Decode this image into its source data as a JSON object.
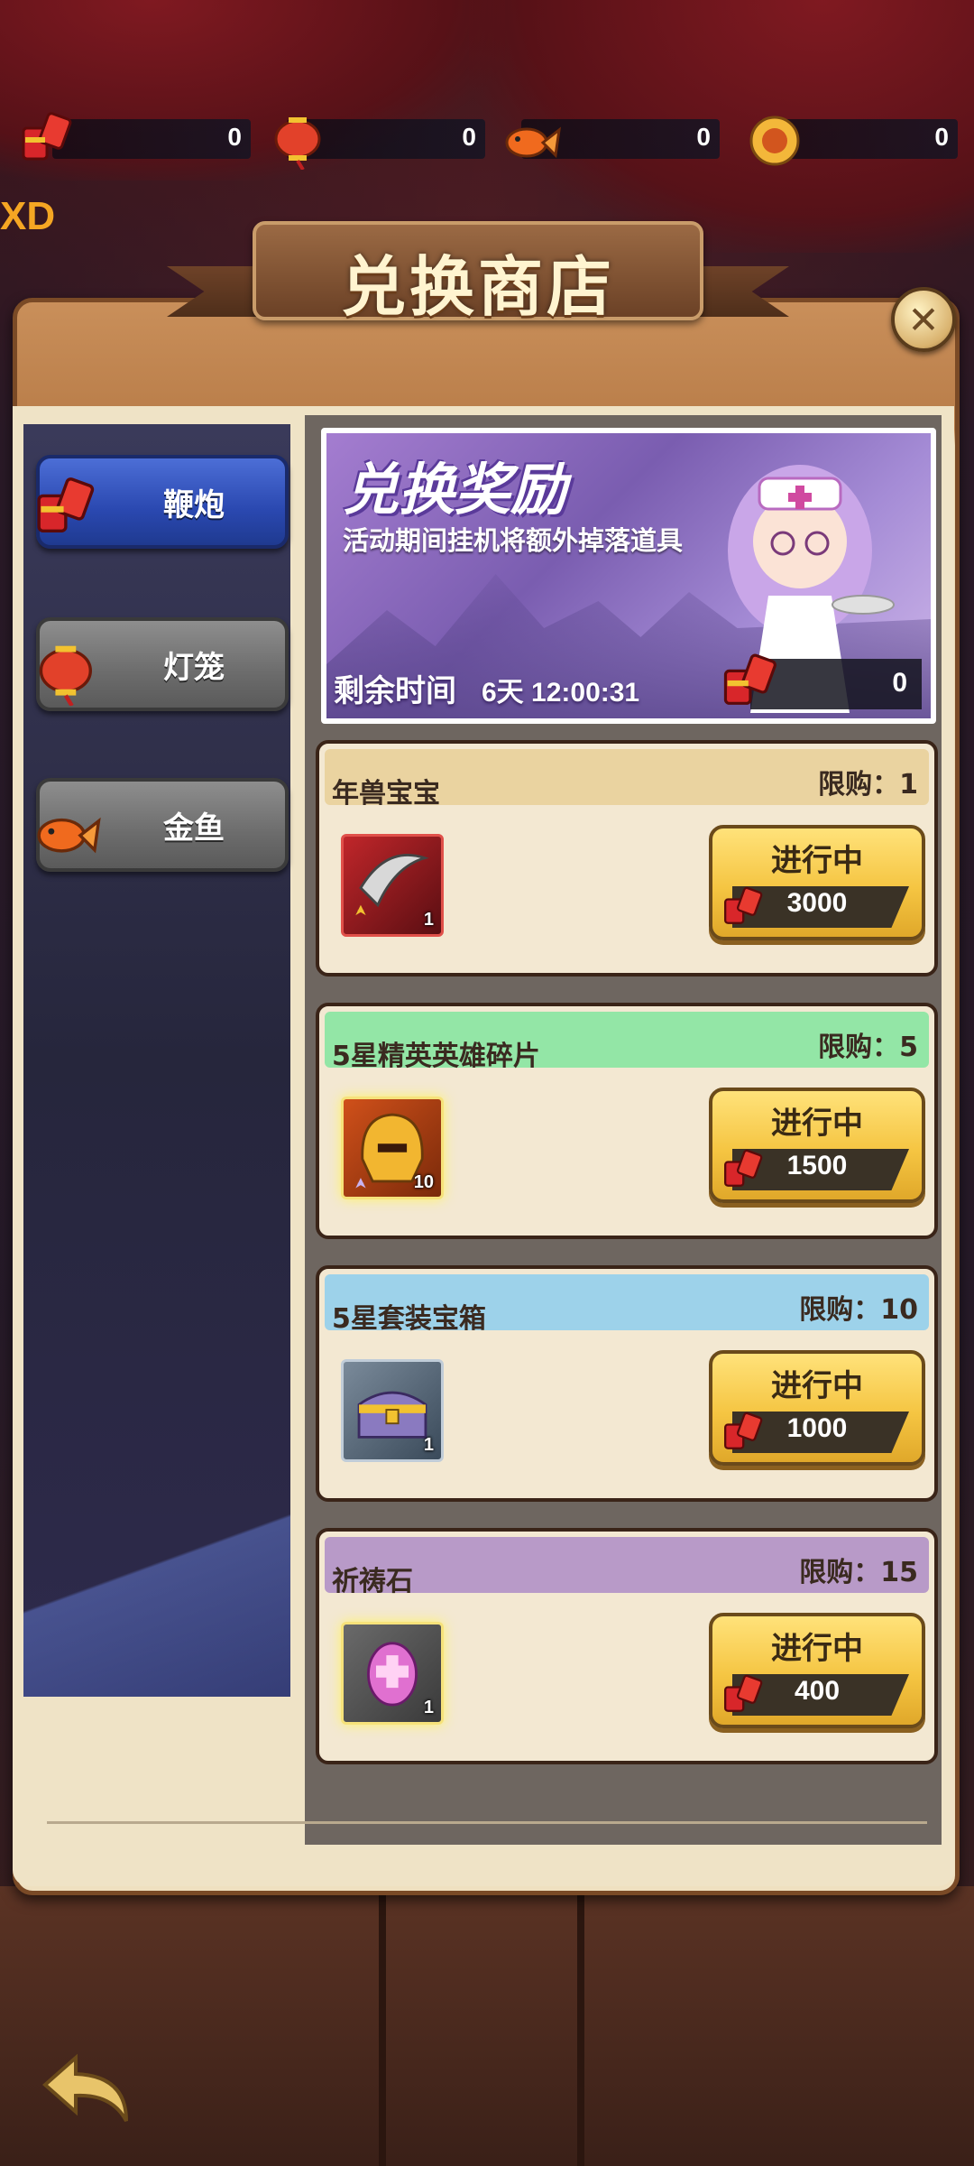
{
  "top_bar": {
    "currencies": [
      {
        "name": "firecracker-icon",
        "value": "0"
      },
      {
        "name": "lantern-icon",
        "value": "0"
      },
      {
        "name": "goldfish-icon",
        "value": "0"
      },
      {
        "name": "gold-coin-icon",
        "value": "0"
      }
    ],
    "edge_label": "XD"
  },
  "title": "兑换商店",
  "categories": [
    {
      "label": "鞭炮",
      "icon": "firecracker-icon",
      "active": true
    },
    {
      "label": "灯笼",
      "icon": "lantern-icon",
      "active": false
    },
    {
      "label": "金鱼",
      "icon": "goldfish-icon",
      "active": false
    }
  ],
  "banner": {
    "title": "兑换奖励",
    "subtitle": "活动期间挂机将额外掉落道具",
    "time_label": "剩余时间",
    "time_value": "6天 12:00:31",
    "owned_count": "0"
  },
  "items": [
    {
      "name": "年兽宝宝",
      "limit": "限购：1",
      "count": "1",
      "button": "进行中",
      "price": "3000",
      "header_color": "#ead3a0",
      "icon": "claw-icon"
    },
    {
      "name": "5星精英英雄碎片",
      "limit": "限购：5",
      "count": "10",
      "button": "进行中",
      "price": "1500",
      "header_color": "#93e6a6",
      "icon": "golden-helmet-icon"
    },
    {
      "name": "5星套装宝箱",
      "limit": "限购：10",
      "count": "1",
      "button": "进行中",
      "price": "1000",
      "header_color": "#9dd2ea",
      "icon": "treasure-chest-icon"
    },
    {
      "name": "祈祷石",
      "limit": "限购：15",
      "count": "1",
      "button": "进行中",
      "price": "400",
      "header_color": "#b89ac8",
      "icon": "prayer-stone-icon"
    }
  ],
  "colors": {
    "active_tab": "#2a48b0",
    "inactive_tab": "#6c6c6c",
    "buy_button": "#f5c542",
    "panel": "#efe0c0"
  }
}
